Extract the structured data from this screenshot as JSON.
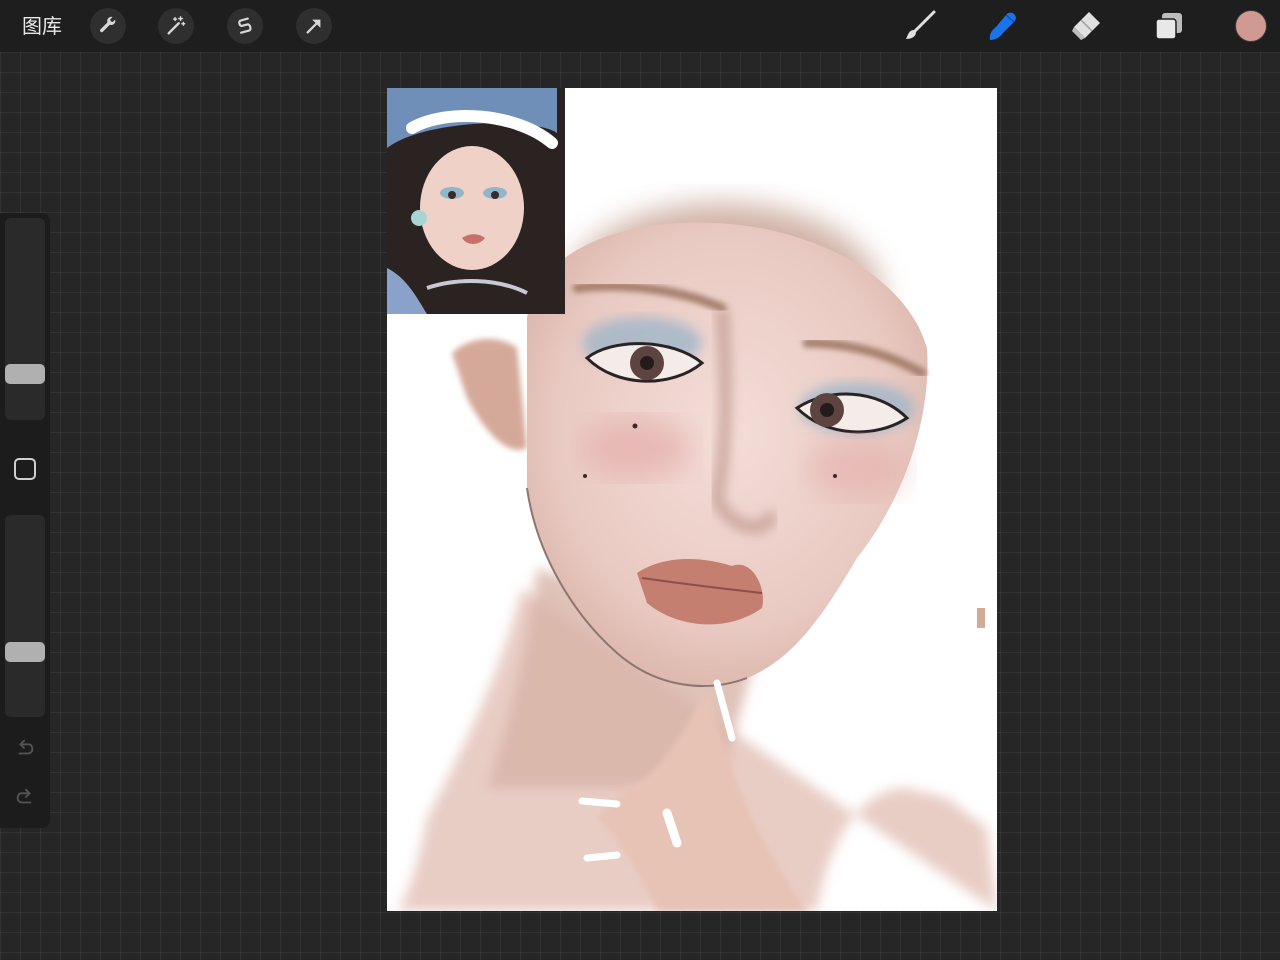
{
  "topbar": {
    "gallery_label": "图库",
    "left_tools": [
      {
        "name": "actions",
        "icon": "wrench-icon"
      },
      {
        "name": "adjustments",
        "icon": "magic-wand-icon"
      },
      {
        "name": "selection",
        "icon": "selection-s-icon"
      },
      {
        "name": "transform",
        "icon": "arrow-cursor-icon"
      }
    ],
    "right_tools": [
      {
        "name": "brush",
        "icon": "brush-icon",
        "active": false
      },
      {
        "name": "smudge",
        "icon": "smudge-finger-icon",
        "active": true
      },
      {
        "name": "eraser",
        "icon": "eraser-icon",
        "active": false
      },
      {
        "name": "layers",
        "icon": "layers-icon",
        "active": false
      }
    ],
    "current_color": "#d09a92",
    "active_color": "#1a73e8"
  },
  "sidebar": {
    "brush_size_level": 0.2,
    "opacity_level": 0.3,
    "modify_icon": "square-icon",
    "undo_icon": "undo-icon",
    "redo_icon": "redo-icon"
  },
  "canvas": {
    "background": "#ffffff",
    "reference_image": "reference-photo",
    "artwork": "face-painting-in-progress"
  }
}
